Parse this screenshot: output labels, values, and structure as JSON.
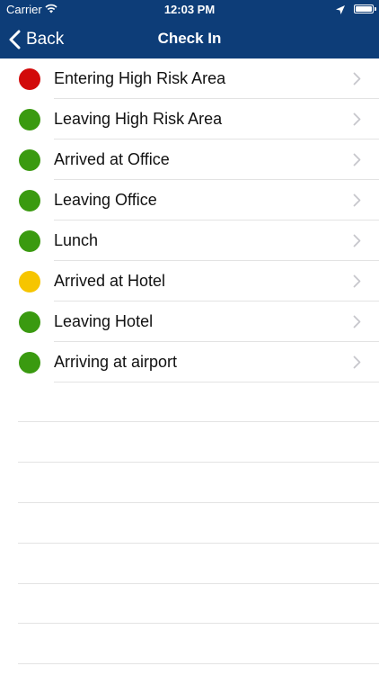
{
  "status_bar": {
    "carrier": "Carrier",
    "time": "12:03 PM"
  },
  "nav": {
    "back_label": "Back",
    "title": "Check In"
  },
  "colors": {
    "red": "#d20a0a",
    "green": "#3a9a10",
    "yellow": "#f6c500",
    "navbar": "#0d3d78"
  },
  "items": [
    {
      "label": "Entering High Risk Area",
      "status": "red"
    },
    {
      "label": "Leaving High Risk Area",
      "status": "green"
    },
    {
      "label": "Arrived at Office",
      "status": "green"
    },
    {
      "label": "Leaving Office",
      "status": "green"
    },
    {
      "label": "Lunch",
      "status": "green"
    },
    {
      "label": "Arrived at Hotel",
      "status": "yellow"
    },
    {
      "label": "Leaving Hotel",
      "status": "green"
    },
    {
      "label": "Arriving at airport",
      "status": "green"
    }
  ]
}
